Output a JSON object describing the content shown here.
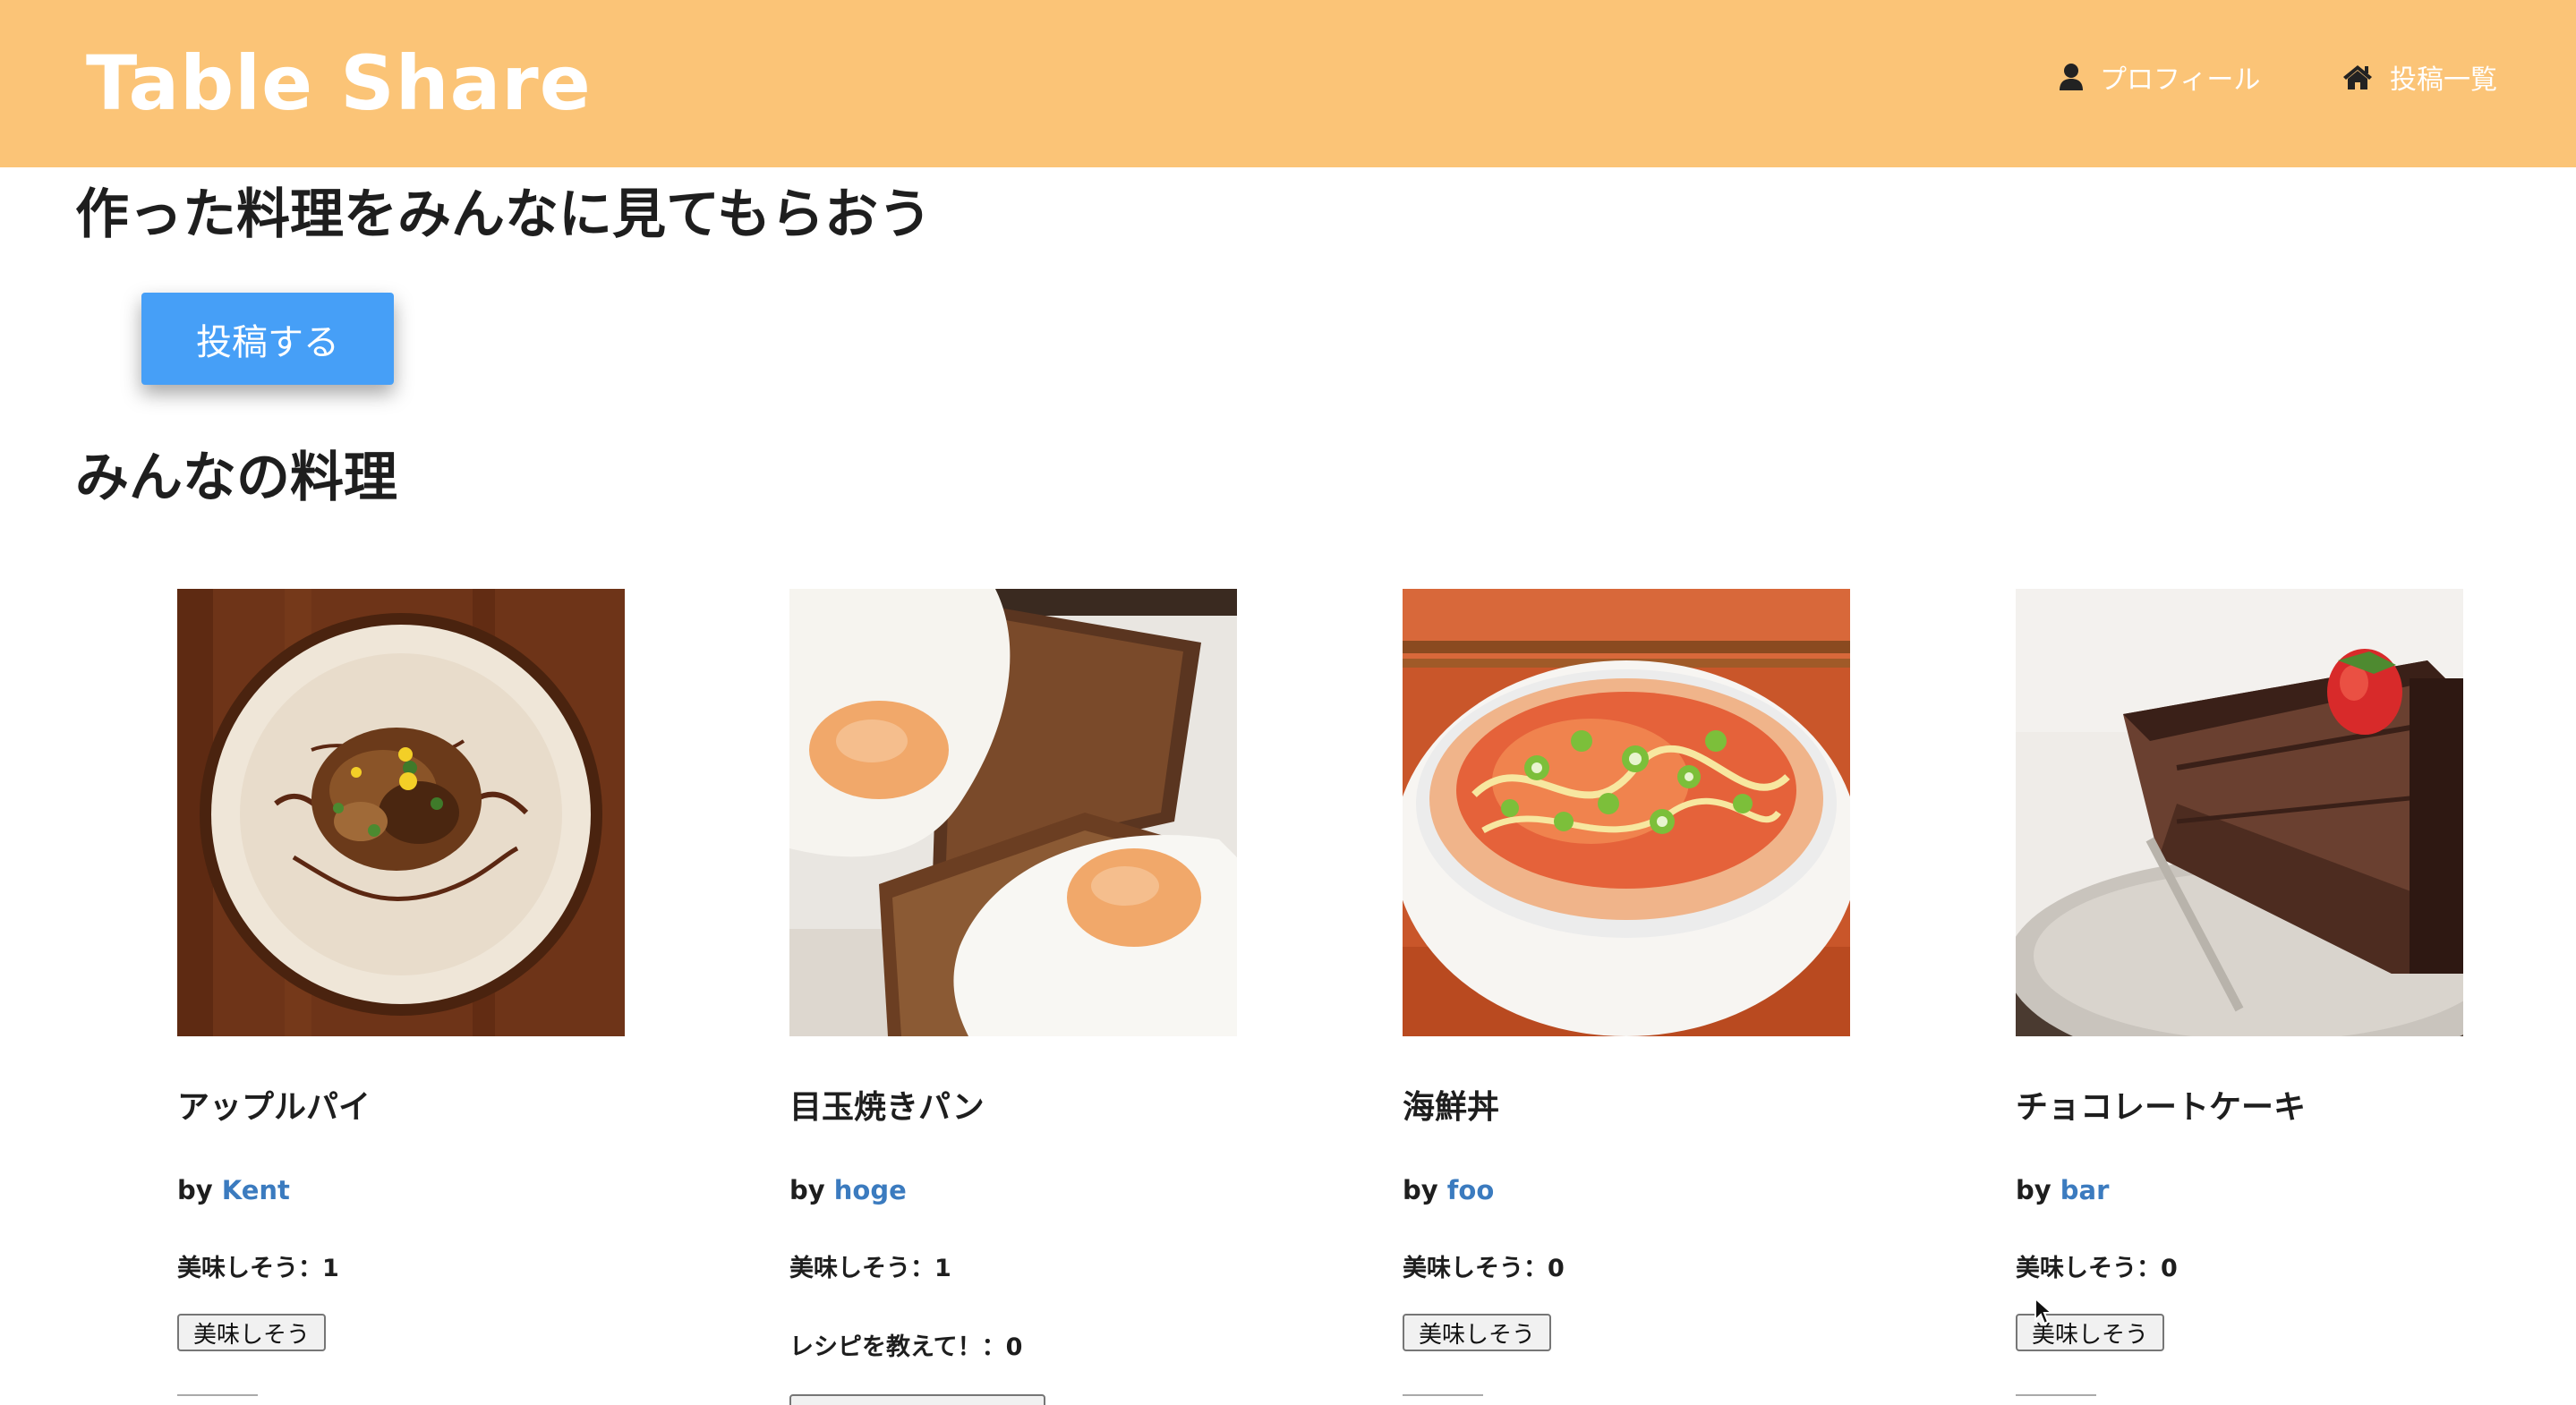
{
  "header": {
    "brand": "Table Share",
    "nav": {
      "profile_label": "プロフィール",
      "profile_icon": "user-icon",
      "posts_label": "投稿一覧",
      "posts_icon": "home-icon"
    }
  },
  "main": {
    "lead": "作った料理をみんなに見てもらおう",
    "post_button_label": "投稿する",
    "section_title": "みんなの料理"
  },
  "posts": [
    {
      "title": "アップルパイ",
      "by": "by",
      "author": "Kent",
      "likes_text": "美味しそう：1",
      "like_button_label": "美味しそう"
    },
    {
      "title": "目玉焼きパン",
      "by": "by",
      "author": "hoge",
      "likes_text": "美味しそう：1",
      "recipe_text": "レシピを教えて！：0"
    },
    {
      "title": "海鮮丼",
      "by": "by",
      "author": "foo",
      "likes_text": "美味しそう：0",
      "like_button_label": "美味しそう"
    },
    {
      "title": "チョコレートケーキ",
      "by": "by",
      "author": "bar",
      "likes_text": "美味しそう：0",
      "like_button_label": "美味しそう"
    }
  ],
  "colors": {
    "header_bg": "#fbc477",
    "primary_button": "#469ff7",
    "link": "#3b7bbf"
  }
}
